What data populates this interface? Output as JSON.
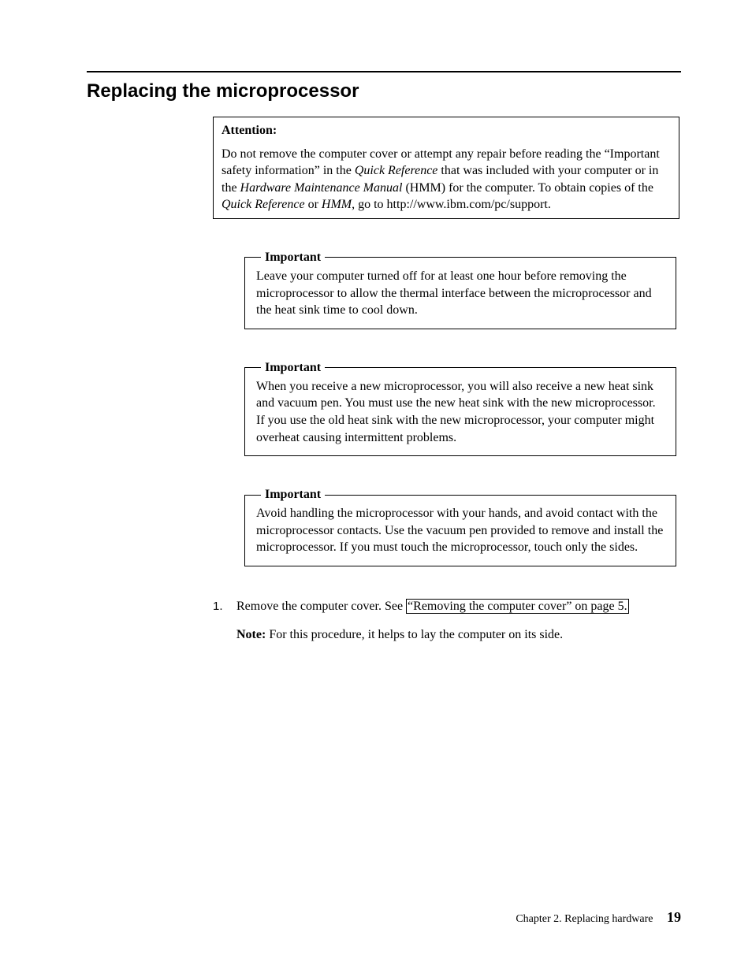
{
  "section": {
    "title": "Replacing the microprocessor"
  },
  "attention": {
    "label": "Attention:",
    "text_prefix": "Do not remove the computer cover or attempt any repair before reading the “Important safety information” in the ",
    "ref1": "Quick Reference",
    "text_mid1": " that was included with your computer or in the ",
    "ref2": "Hardware Maintenance Manual",
    "text_mid2": " (HMM) for the computer. To obtain copies of the ",
    "ref3": "Quick Reference",
    "text_mid3": " or ",
    "ref4": "HMM",
    "text_suffix": ", go to http://www.ibm.com/pc/support."
  },
  "important_boxes": [
    {
      "legend": "Important",
      "body": "Leave your computer turned off for at least one hour before removing the microprocessor to allow the thermal interface between the microprocessor and the heat sink time to cool down."
    },
    {
      "legend": "Important",
      "body": "When you receive a new microprocessor, you will also receive a new heat sink and vacuum pen. You must use the new heat sink with the new microprocessor. If you use the old heat sink with the new microprocessor, your computer might overheat causing intermittent problems."
    },
    {
      "legend": "Important",
      "body": "Avoid handling the microprocessor with your hands, and avoid contact with the microprocessor contacts. Use the vacuum pen provided to remove and install the microprocessor. If you must touch the microprocessor, touch only the sides."
    }
  ],
  "steps": [
    {
      "number": "1.",
      "text_prefix": "Remove the computer cover. See ",
      "link_text": "“Removing the computer cover” on page 5.",
      "note_label": "Note:",
      "note_text": " For this procedure, it helps to lay the computer on its side."
    }
  ],
  "footer": {
    "chapter": "Chapter 2. Replacing hardware",
    "page": "19"
  }
}
